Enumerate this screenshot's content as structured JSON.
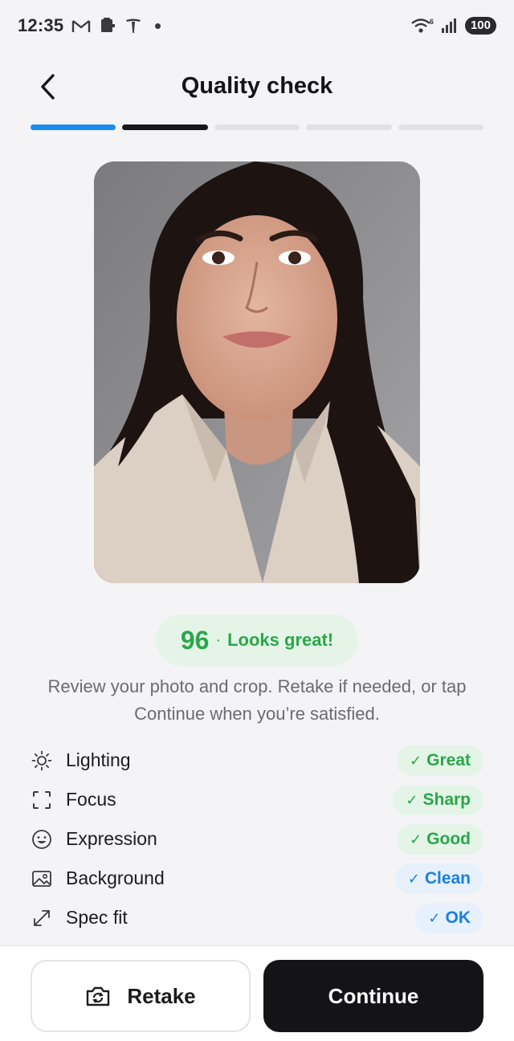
{
  "status_bar": {
    "time": "12:35",
    "battery": "100",
    "signal_label": "6",
    "icons": [
      "gmail-icon",
      "clipboard-icon",
      "tesla-icon",
      "notification-dot",
      "wifi-icon",
      "signal-icon",
      "battery-icon"
    ]
  },
  "header": {
    "title": "Quality check",
    "back_icon": "chevron-left-icon"
  },
  "progress": {
    "total_steps": 5,
    "steps": [
      "active",
      "done",
      "pending",
      "pending",
      "pending"
    ],
    "active_color": "#1a8cf0",
    "done_color": "#17181b"
  },
  "photo": {
    "subject": "portrait"
  },
  "score": {
    "value": "96",
    "separator": "·",
    "label": "Looks great!",
    "color": "#2aa74a"
  },
  "description": "Review your photo and crop. Retake if needed, or tap Continue when you’re satisfied.",
  "checks": [
    {
      "icon": "sun-icon",
      "label": "Lighting",
      "status": "Great",
      "tone": "green"
    },
    {
      "icon": "focus-frame-icon",
      "label": "Focus",
      "status": "Sharp",
      "tone": "green"
    },
    {
      "icon": "smiley-icon",
      "label": "Expression",
      "status": "Good",
      "tone": "green"
    },
    {
      "icon": "image-icon",
      "label": "Background",
      "status": "Clean",
      "tone": "blue"
    },
    {
      "icon": "resize-arrow-icon",
      "label": "Spec fit",
      "status": "OK",
      "tone": "blue"
    }
  ],
  "check_tick": "✓",
  "actions": {
    "retake_label": "Retake",
    "retake_icon": "camera-rotate-icon",
    "continue_label": "Continue"
  }
}
